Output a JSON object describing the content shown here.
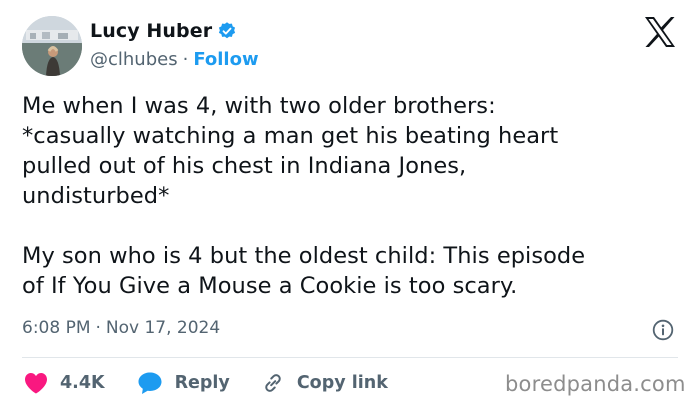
{
  "author": {
    "name": "Lucy Huber",
    "handle": "@clhubes",
    "separator": "·",
    "follow_label": "Follow",
    "verified": true
  },
  "tweet": {
    "text": "Me when I was 4, with two older brothers:\n*casually watching a man get his beating heart\npulled out of his chest in Indiana Jones,\nundisturbed*\n\nMy son who is 4 but the oldest child: This episode\nof If You Give a Mouse a Cookie is too scary.",
    "time": "6:08 PM",
    "time_separator": "·",
    "date": "Nov 17, 2024"
  },
  "actions": {
    "likes": "4.4K",
    "reply_label": "Reply",
    "copy_link_label": "Copy link"
  },
  "icons": {
    "like": "heart-icon",
    "reply": "speech-bubble-icon",
    "copy": "link-icon",
    "info": "info-icon",
    "logo": "x-logo-icon",
    "verified": "verified-badge-icon"
  },
  "colors": {
    "text": "#0f1419",
    "secondary": "#536471",
    "accent": "#1d9bf0",
    "like": "#f91880"
  },
  "watermark": "boredpanda.com"
}
